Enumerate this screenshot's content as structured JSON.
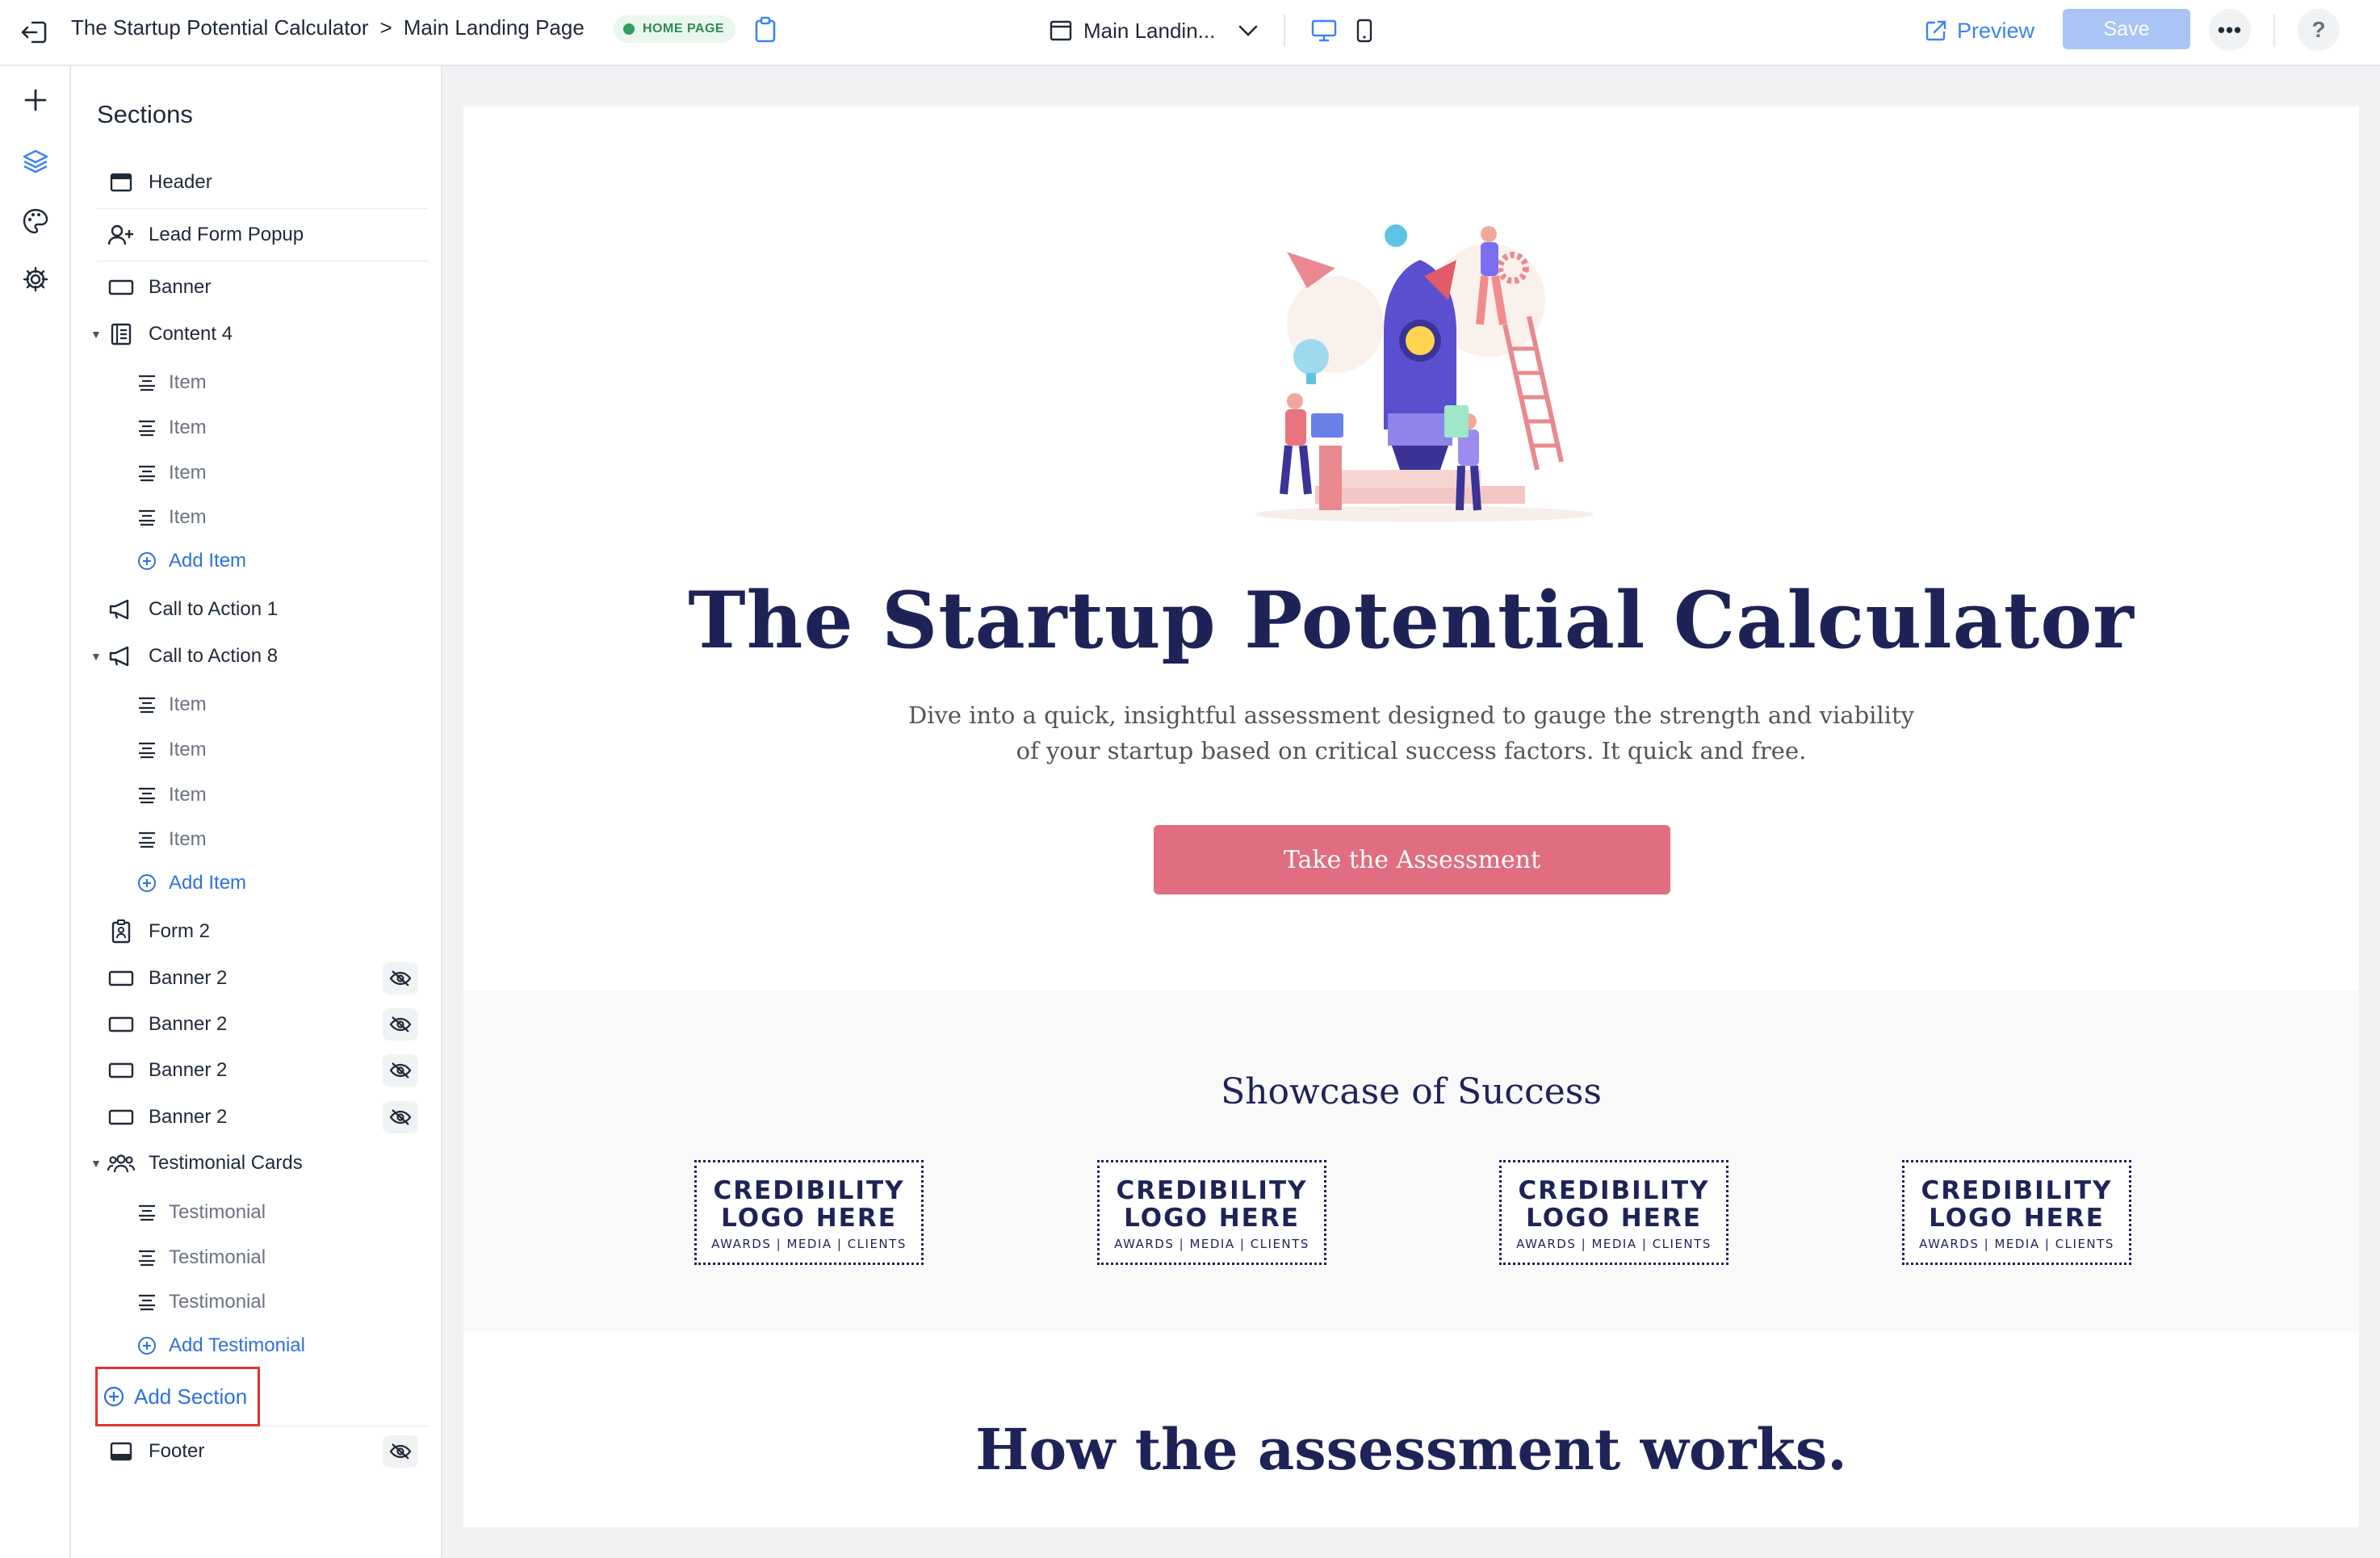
{
  "topbar": {
    "breadcrumb_project": "The Startup Potential Calculator",
    "breadcrumb_separator": ">",
    "breadcrumb_page": "Main Landing Page",
    "badge": "HOME PAGE",
    "page_selector": "Main Landin...",
    "preview_label": "Preview",
    "save_label": "Save",
    "more_label": "•••",
    "help_label": "?"
  },
  "rail": {
    "icons": [
      "plus-icon",
      "layers-icon",
      "palette-icon",
      "gear-icon"
    ]
  },
  "sections": {
    "title": "Sections",
    "header": "Header",
    "lead_form": "Lead Form Popup",
    "banner": "Banner",
    "content4": "Content 4",
    "item": "Item",
    "add_item": "Add Item",
    "cta1": "Call to Action 1",
    "cta8": "Call to Action 8",
    "form2": "Form 2",
    "banner2": "Banner 2",
    "testimonial_cards": "Testimonial Cards",
    "testimonial": "Testimonial",
    "add_testimonial": "Add Testimonial",
    "add_section": "Add Section",
    "footer": "Footer"
  },
  "canvas": {
    "hero_title": "The Startup Potential Calculator",
    "hero_sub_line1": "Dive into a quick, insightful assessment designed to gauge the strength and viability",
    "hero_sub_line2": "of your startup based on critical success factors. It quick and free.",
    "cta_label": "Take the Assessment",
    "showcase_title": "Showcase of Success",
    "logo_line1": "CREDIBILITY",
    "logo_line2": "LOGO HERE",
    "logo_line3": "AWARDS | MEDIA | CLIENTS",
    "how_title": "How the assessment works."
  },
  "colors": {
    "accent": "#3b82f6",
    "navy": "#1e2357",
    "cta": "#e16d80",
    "save_disabled": "#a9c4f5",
    "highlight": "#e0342e"
  }
}
